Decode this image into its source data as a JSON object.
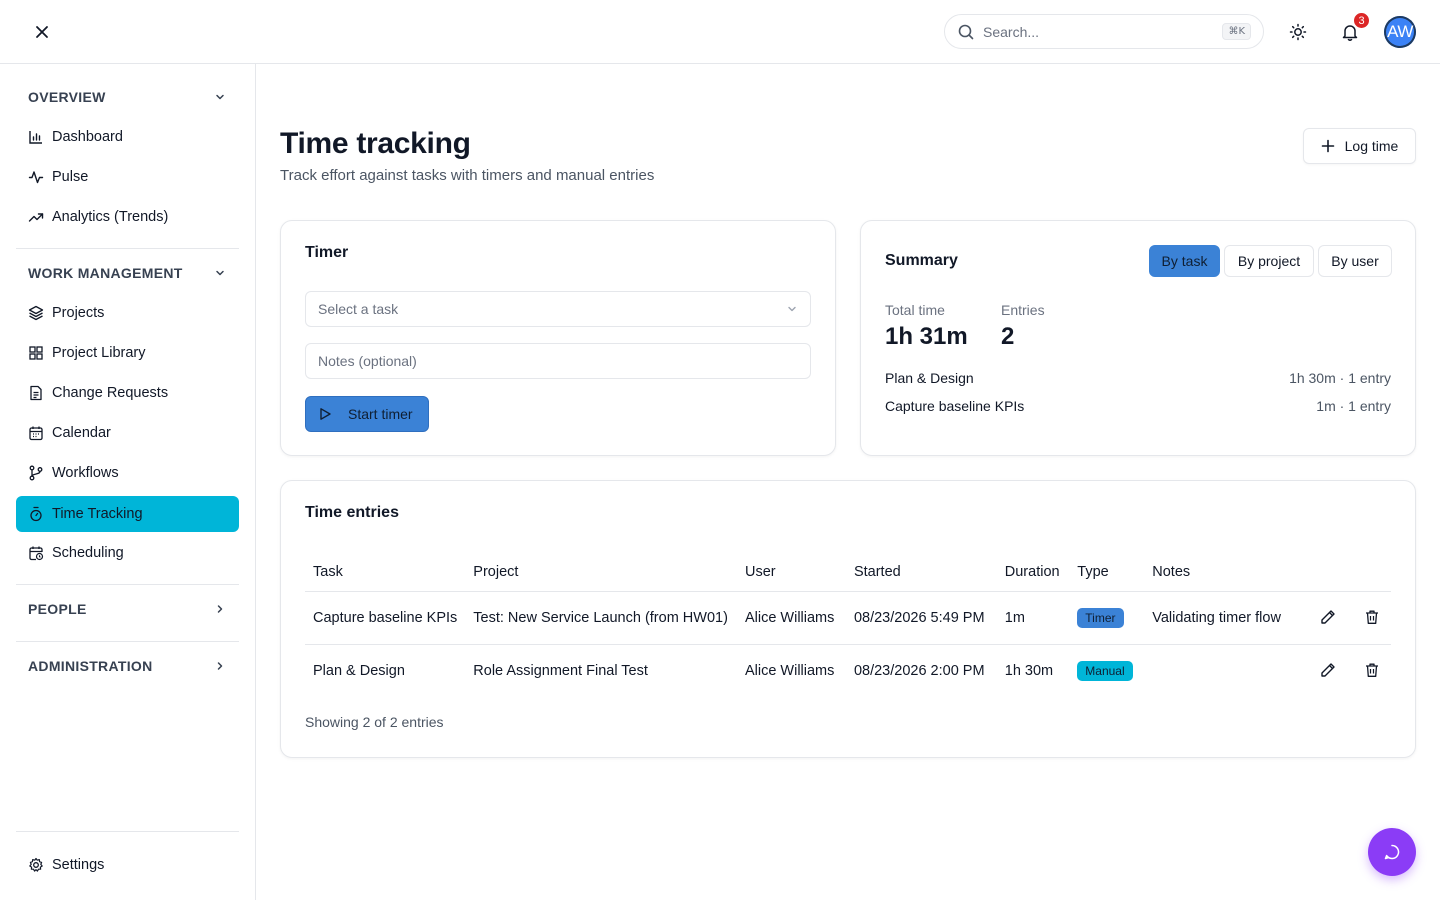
{
  "topbar": {
    "search": {
      "placeholder": "Search...",
      "shortcut": "⌘K"
    },
    "notifications_count": "3",
    "avatar_initials": "AW"
  },
  "sidebar": {
    "sections": [
      {
        "label": "OVERVIEW",
        "expanded": true,
        "items": [
          {
            "label": "Dashboard",
            "icon": "bar-chart-icon"
          },
          {
            "label": "Pulse",
            "icon": "activity-icon"
          },
          {
            "label": "Analytics (Trends)",
            "icon": "trending-up-icon"
          }
        ]
      },
      {
        "label": "WORK MANAGEMENT",
        "expanded": true,
        "items": [
          {
            "label": "Projects",
            "icon": "layers-icon"
          },
          {
            "label": "Project Library",
            "icon": "grid-icon"
          },
          {
            "label": "Change Requests",
            "icon": "file-text-icon"
          },
          {
            "label": "Calendar",
            "icon": "calendar-icon"
          },
          {
            "label": "Workflows",
            "icon": "git-branch-icon"
          },
          {
            "label": "Time Tracking",
            "icon": "timer-icon",
            "active": true
          },
          {
            "label": "Scheduling",
            "icon": "calendar-clock-icon"
          }
        ]
      },
      {
        "label": "PEOPLE",
        "expanded": false
      },
      {
        "label": "ADMINISTRATION",
        "expanded": false
      }
    ],
    "settings_label": "Settings"
  },
  "header": {
    "title": "Time tracking",
    "subtitle": "Track effort against tasks with timers and manual entries",
    "log_time_label": "Log time"
  },
  "timer": {
    "title": "Timer",
    "task_placeholder": "Select a task",
    "notes_placeholder": "Notes (optional)",
    "start_label": "Start timer"
  },
  "summary": {
    "title": "Summary",
    "tabs": [
      "By task",
      "By project",
      "By user"
    ],
    "active_tab": "By task",
    "total_time_label": "Total time",
    "total_time_value": "1h 31m",
    "entries_label": "Entries",
    "entries_value": "2",
    "rows": [
      {
        "name": "Plan & Design",
        "meta": "1h 30m · 1 entry"
      },
      {
        "name": "Capture baseline KPIs",
        "meta": "1m · 1 entry"
      }
    ]
  },
  "entries": {
    "title": "Time entries",
    "columns": [
      "Task",
      "Project",
      "User",
      "Started",
      "Duration",
      "Type",
      "Notes"
    ],
    "rows": [
      {
        "task": "Capture baseline KPIs",
        "project": "Test: New Service Launch (from HW01)",
        "user": "Alice Williams",
        "started": "08/23/2026 5:49 PM",
        "duration": "1m",
        "type": "Timer",
        "notes": "Validating timer flow"
      },
      {
        "task": "Plan & Design",
        "project": "Role Assignment Final Test",
        "user": "Alice Williams",
        "started": "08/23/2026 2:00 PM",
        "duration": "1h 30m",
        "type": "Manual",
        "notes": ""
      }
    ],
    "footer": "Showing 2 of 2 entries"
  },
  "colors": {
    "accent": "#3b82d6",
    "active_nav": "#00b5d8",
    "chat": "#8b3cf6",
    "badge_red": "#dc2626"
  }
}
